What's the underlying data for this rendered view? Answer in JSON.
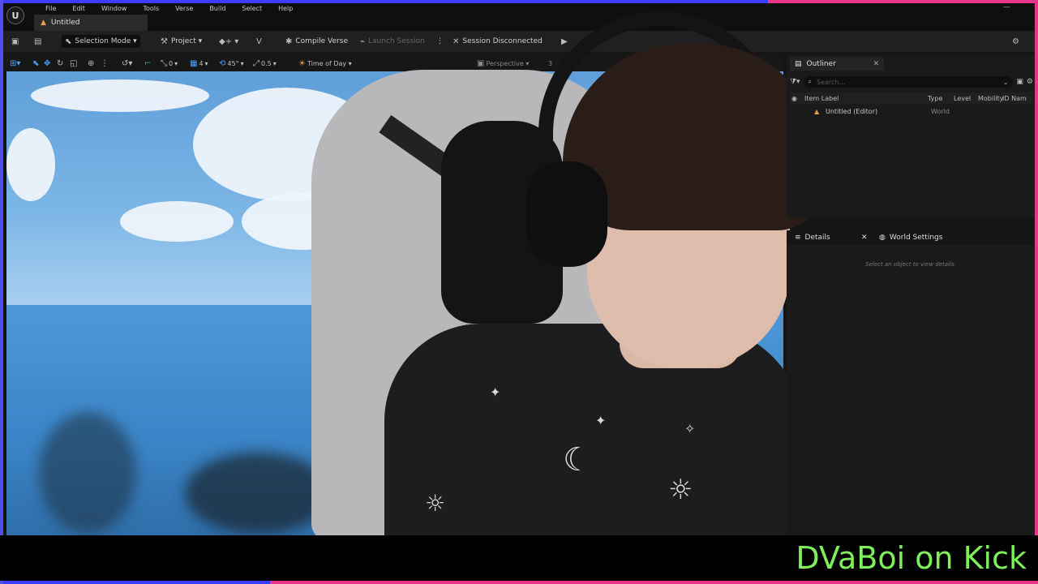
{
  "menu": [
    "File",
    "Edit",
    "Window",
    "Tools",
    "Verse",
    "Build",
    "Select",
    "Help"
  ],
  "logo_glyph": "U",
  "window_controls": "— ",
  "doc_tab": {
    "label": "Untitled"
  },
  "toolbar": {
    "selection_mode": "Selection Mode ▾",
    "project": "Project ▾",
    "compile_verse": "Compile Verse",
    "launch_session": "Launch Session",
    "session_status": "Session Disconnected",
    "more": "⋮"
  },
  "viewport_toolbar": {
    "translate_snap": "0",
    "grid": "4",
    "rotate_snap": "45°",
    "scale_snap": "0.5",
    "time_of_day": "Time of Day ▾",
    "perspective": "Perspective ▾",
    "fov": "3"
  },
  "outliner": {
    "tab_label": "Outliner",
    "search_placeholder": "Search...",
    "columns": {
      "item_label": "Item Label",
      "type": "Type",
      "level": "Level",
      "mobility": "Mobility",
      "id_name": "ID Nam"
    },
    "rows": [
      {
        "label": "Untitled (Editor)",
        "type": "World"
      }
    ]
  },
  "details": {
    "tab_details": "Details",
    "tab_world_settings": "World Settings",
    "placeholder": "Select an object to view details."
  },
  "caption": "DVaBoi on Kick",
  "colors": {
    "caption": "#7df05a",
    "frame_blue": "#3c3cff",
    "frame_pink": "#e8368c",
    "accent": "#4aa3ff"
  }
}
